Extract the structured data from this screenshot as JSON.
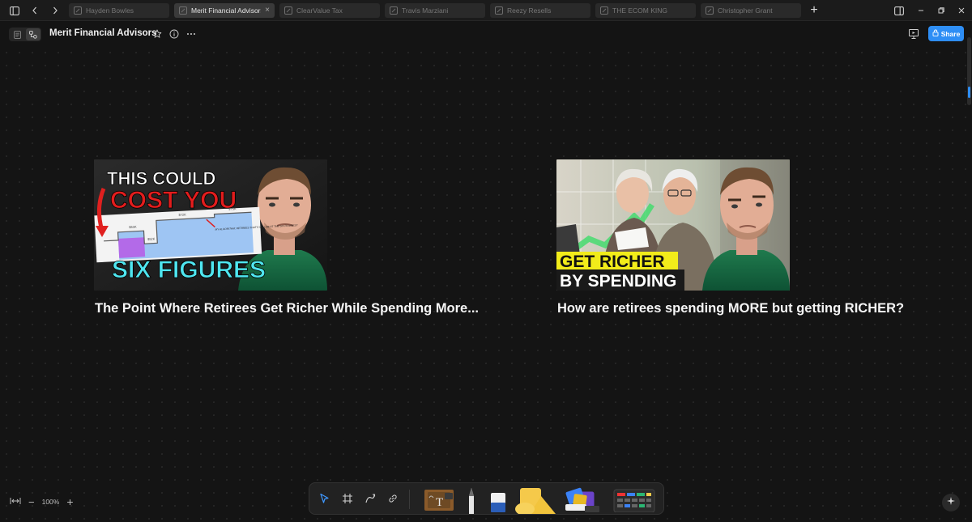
{
  "tabbar": {
    "tabs": [
      {
        "label": "Hayden Bowles",
        "active": false
      },
      {
        "label": "Merit Financial Advisors",
        "active": true
      },
      {
        "label": "ClearValue Tax",
        "active": false
      },
      {
        "label": "Travis Marziani",
        "active": false
      },
      {
        "label": "Reezy Resells",
        "active": false
      },
      {
        "label": "THE ECOM KING",
        "active": false
      },
      {
        "label": "Christopher Grant",
        "active": false
      }
    ],
    "close_symbol": "×",
    "new_tab_symbol": "+"
  },
  "header": {
    "title": "Merit Financial Advisors",
    "share_label": "Share"
  },
  "cards": [
    {
      "title": "The Point Where Retirees Get Richer While Spending More...",
      "thumbnail": {
        "line1": "THIS COULD",
        "line2": "COST YOU",
        "line3": "SIX FIGURES",
        "chart_labels": [
          "$63K",
          "$52K",
          "$72K",
          "$75K"
        ],
        "annotation": "MY ALGORITHM: RETIREES THAT'S WILL BE AT THE SIX FIGURES?"
      }
    },
    {
      "title": "How are retirees spending MORE but getting RICHER?",
      "thumbnail": {
        "line1": "GET RICHER",
        "line2": "BY SPENDING"
      }
    }
  ],
  "zoom": {
    "value": "100%",
    "minus": "−",
    "plus": "+"
  },
  "toolbar": {
    "tools": [
      "select-tool",
      "frame-tool",
      "connector-tool",
      "link-tool",
      "text-tool",
      "pen-tool",
      "eraser-tool",
      "shapes-tool",
      "stickers-tool",
      "templates-tool"
    ]
  },
  "colors": {
    "accent": "#2e8ef5",
    "canvas": "#141414",
    "tab_active": "#3a3a3a"
  }
}
